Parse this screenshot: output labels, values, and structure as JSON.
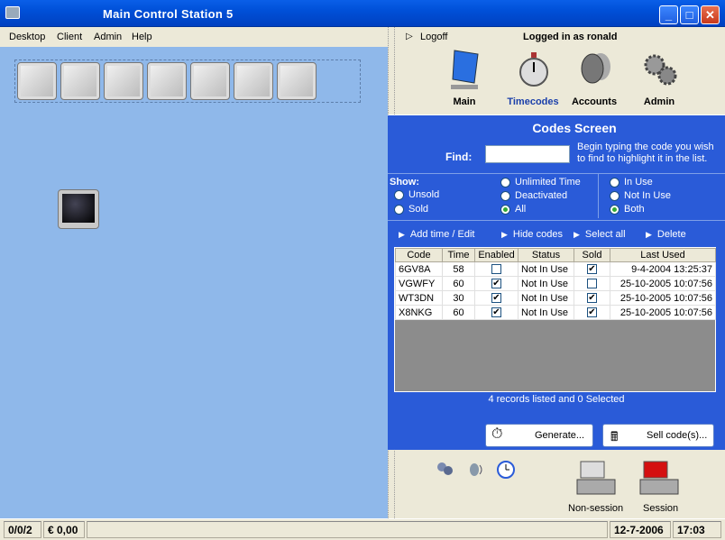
{
  "window": {
    "title": "Main Control Station  5",
    "minimize": "_",
    "maximize": "□",
    "close": "✕"
  },
  "menu": {
    "desktop": "Desktop",
    "client": "Client",
    "admin": "Admin",
    "help": "Help"
  },
  "topbar": {
    "logoff": "Logoff",
    "logged_in": "Logged in as ronald"
  },
  "nav": {
    "main": "Main",
    "timecodes": "Timecodes",
    "accounts": "Accounts",
    "admin": "Admin"
  },
  "codes": {
    "title": "Codes Screen",
    "find_label": "Find:",
    "find_value": "",
    "hint": "Begin typing the code you wish to find to highlight it in the list.",
    "show_label": "Show:",
    "options": {
      "unsold": "Unsold",
      "sold": "Sold",
      "unlimited": "Unlimited Time",
      "deactivated": "Deactivated",
      "all": "All",
      "in_use": "In Use",
      "not_in_use": "Not In Use",
      "both": "Both"
    },
    "actions": {
      "add": "Add time / Edit",
      "hide": "Hide codes",
      "select_all": "Select all",
      "delete": "Delete"
    },
    "columns": [
      "Code",
      "Time",
      "Enabled",
      "Status",
      "Sold",
      "Last Used"
    ],
    "rows": [
      {
        "code": "6GV8A",
        "time": "58",
        "enabled": false,
        "status": "Not In Use",
        "sold": true,
        "last_used": "9-4-2004 13:25:37"
      },
      {
        "code": "VGWFY",
        "time": "60",
        "enabled": true,
        "status": "Not In Use",
        "sold": false,
        "last_used": "25-10-2005 10:07:56"
      },
      {
        "code": "WT3DN",
        "time": "30",
        "enabled": true,
        "status": "Not In Use",
        "sold": true,
        "last_used": "25-10-2005 10:07:56"
      },
      {
        "code": "X8NKG",
        "time": "60",
        "enabled": true,
        "status": "Not In Use",
        "sold": true,
        "last_used": "25-10-2005 10:07:56"
      }
    ],
    "records": "4 records listed and 0 Selected",
    "generate": "Generate...",
    "sell": "Sell code(s)..."
  },
  "tills": {
    "non_session": "Non-session",
    "session": "Session"
  },
  "status": {
    "counts": "0/0/2",
    "balance": "€ 0,00",
    "date": "12-7-2006",
    "time": "17:03"
  }
}
